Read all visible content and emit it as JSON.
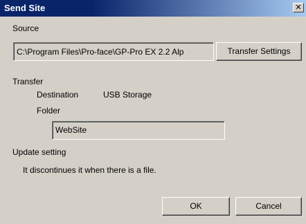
{
  "window": {
    "title": "Send Site",
    "close_glyph": "✕"
  },
  "source": {
    "label": "Source",
    "path_value": "C:\\Program Files\\Pro-face\\GP-Pro EX 2.2 Alp",
    "transfer_settings_label": "Transfer Settings"
  },
  "transfer": {
    "label": "Transfer",
    "destination_label": "Destination",
    "destination_value": "USB Storage",
    "folder_label": "Folder",
    "folder_value": "WebSite"
  },
  "update": {
    "label": "Update setting",
    "description": "It discontinues it when there is a file."
  },
  "buttons": {
    "ok_label": "OK",
    "cancel_label": "Cancel"
  }
}
